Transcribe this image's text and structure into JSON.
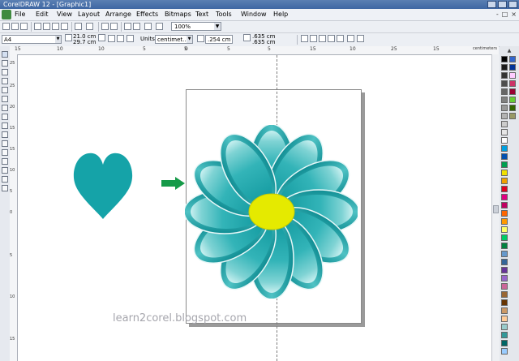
{
  "window": {
    "title": "CorelDRAW 12 - [Graphic1]"
  },
  "menu": [
    "File",
    "Edit",
    "View",
    "Layout",
    "Arrange",
    "Effects",
    "Bitmaps",
    "Text",
    "Tools",
    "Window",
    "Help"
  ],
  "mdi_controls": [
    "-",
    "□",
    "×"
  ],
  "toolbar": {
    "zoom": "100%"
  },
  "propbar": {
    "paper": "A4",
    "width": "21.0 cm",
    "height": "29.7 cm",
    "units_label": "Units:",
    "units_value": "centimet...",
    "nudge": ".254 cm",
    "dup_x": ".635 cm",
    "dup_y": ".635 cm"
  },
  "ruler": {
    "h_labels": [
      "15",
      "10",
      "5",
      "0",
      "5",
      "10",
      "15",
      "20",
      "25",
      "30"
    ],
    "v_labels": [
      "25",
      "20",
      "15",
      "10",
      "5",
      "0"
    ],
    "unit": "centimeters"
  },
  "canvas": {
    "watermark": "learn2corel.blogspot.com",
    "colors": {
      "heart": "#15a3a8",
      "arrow": "#159a48",
      "petal_dark": "#12999f",
      "petal_light": "#c9f0f0",
      "center": "#e5ea00"
    }
  },
  "palette": [
    "#000000",
    "#1a1a1a",
    "#333333",
    "#4d4d4d",
    "#666666",
    "#808080",
    "#999999",
    "#b3b3b3",
    "#cccccc",
    "#e6e6e6",
    "#ffffff",
    "#00a0e0",
    "#0050b0",
    "#00a050",
    "#f0e000",
    "#f0a000",
    "#e00020",
    "#e00080",
    "#c00060",
    "#ff6600",
    "#ff9900",
    "#ffff66",
    "#00cc66",
    "#008040",
    "#6699cc",
    "#336699",
    "#663399",
    "#9966cc",
    "#cc6699",
    "#996633",
    "#663300",
    "#cc9966",
    "#ffcc99",
    "#99cccc",
    "#339999",
    "#006666",
    "#99ccff",
    "#3366cc",
    "#003399",
    "#ffccff",
    "#cc3366",
    "#990033",
    "#66cc33",
    "#336600",
    "#999966"
  ]
}
